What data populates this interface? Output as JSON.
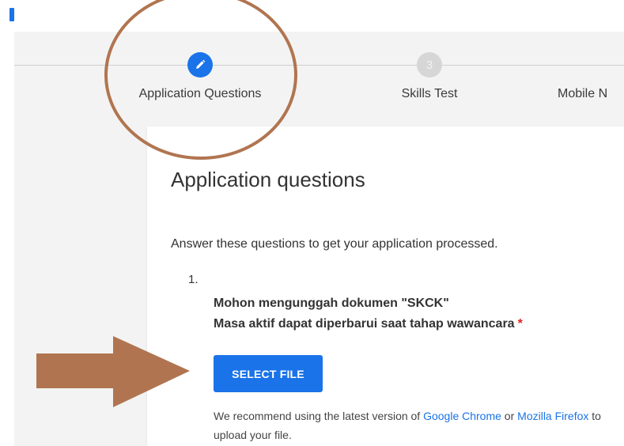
{
  "stepper": {
    "steps": [
      {
        "label": "Application Questions",
        "icon": "pencil-icon",
        "number": "",
        "state": "active"
      },
      {
        "label": "Skills Test",
        "number": "3",
        "state": "inactive"
      },
      {
        "label": "Mobile N",
        "number": "",
        "state": "inactive"
      }
    ]
  },
  "card": {
    "title": "Application questions",
    "intro": "Answer these questions to get your application processed.",
    "question": {
      "number": "1.",
      "line1": "Mohon mengunggah dokumen \"SKCK\"",
      "line2": "Masa aktif dapat diperbarui saat tahap wawancara",
      "required_marker": "*"
    },
    "select_file_label": "SELECT FILE",
    "recommend": {
      "prefix": "We recommend using the latest version of ",
      "chrome_link": "Google Chrome",
      "or": " or ",
      "firefox_link": "Mozilla Firefox",
      "suffix": " to upload your file."
    }
  },
  "colors": {
    "accent": "#1a73e8",
    "annotation": "#b07550",
    "required": "#e02020"
  }
}
